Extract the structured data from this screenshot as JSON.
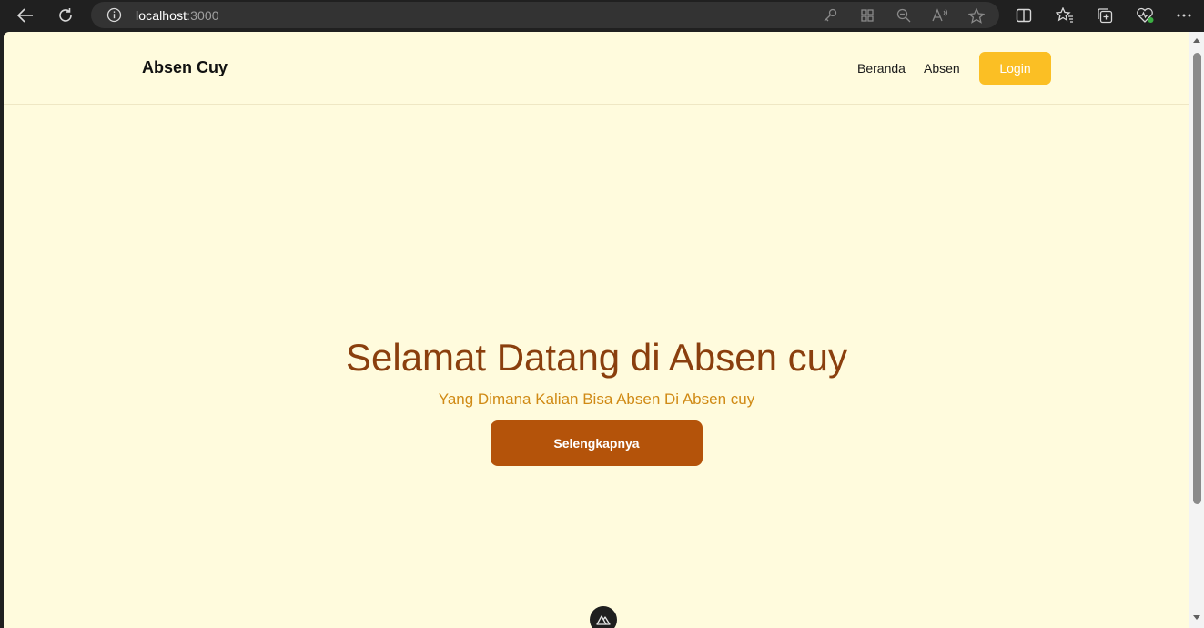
{
  "browser": {
    "url_host": "localhost",
    "url_port": ":3000",
    "icons": [
      "back-icon",
      "refresh-icon",
      "site-info-icon",
      "key-icon",
      "app-available-icon",
      "zoom-out-icon",
      "read-aloud-icon",
      "favorite-star-icon",
      "split-screen-icon",
      "favorites-icon",
      "collections-icon",
      "browser-essentials-icon",
      "more-options-icon"
    ]
  },
  "navbar": {
    "brand": "Absen Cuy",
    "links": [
      "Beranda",
      "Absen"
    ],
    "login_label": "Login"
  },
  "hero": {
    "title": "Selamat Datang di Absen cuy",
    "subtitle": "Yang Dimana Kalian Bisa Absen Di Absen cuy",
    "button_label": "Selengkapnya"
  },
  "colors": {
    "page_background": "#fffbdd",
    "login_button": "#fbbf24",
    "hero_title": "#8a3f0e",
    "hero_subtitle": "#d08a15",
    "hero_button": "#b4530a"
  }
}
